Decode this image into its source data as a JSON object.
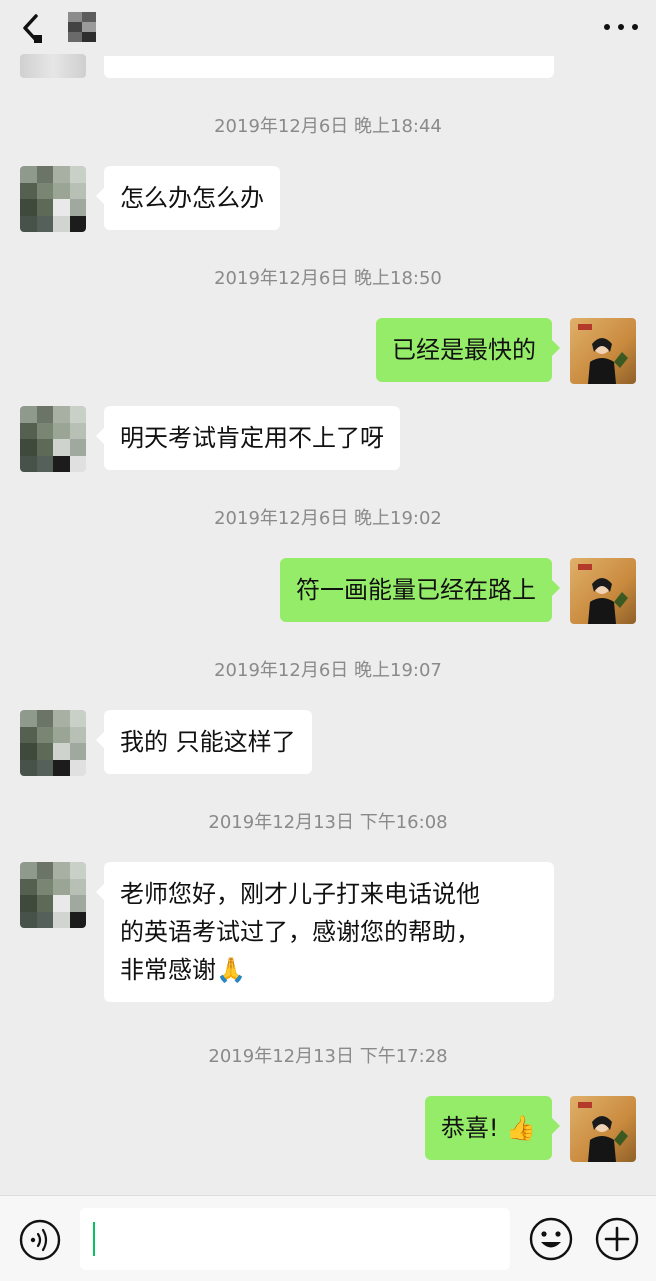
{
  "header": {
    "back_icon": "chevron-left-icon",
    "contact_name_icon": "blurred-name",
    "more_icon": "more-dots-icon"
  },
  "messages": [
    {
      "type": "timestamp",
      "text": "2019年12月6日 晚上18:44"
    },
    {
      "type": "incoming",
      "text": "怎么办怎么办"
    },
    {
      "type": "timestamp",
      "text": "2019年12月6日 晚上18:50"
    },
    {
      "type": "outgoing",
      "text": "已经是最快的"
    },
    {
      "type": "incoming",
      "text": "明天考试肯定用不上了呀"
    },
    {
      "type": "timestamp",
      "text": "2019年12月6日 晚上19:02"
    },
    {
      "type": "outgoing",
      "text": "符一画能量已经在路上"
    },
    {
      "type": "timestamp",
      "text": "2019年12月6日 晚上19:07"
    },
    {
      "type": "incoming",
      "text": "我的 只能这样了"
    },
    {
      "type": "timestamp",
      "text": "2019年12月13日 下午16:08"
    },
    {
      "type": "incoming",
      "lines": [
        "老师您好，刚才儿子打来电话说他",
        "的英语考试过了，感谢您的帮助，",
        "非常感谢"
      ],
      "emoji": "🙏"
    },
    {
      "type": "timestamp",
      "text": "2019年12月13日 下午17:28"
    },
    {
      "type": "outgoing",
      "text": "恭喜!",
      "emoji": "👍"
    }
  ],
  "input_bar": {
    "voice_icon": "voice-icon",
    "input_value": "",
    "emoji_icon": "emoji-smile-icon",
    "plus_icon": "plus-circle-icon"
  },
  "colors": {
    "background": "#ededed",
    "outgoing_bubble": "#95ec69",
    "incoming_bubble": "#ffffff",
    "timestamp_text": "#8a8a8a",
    "cursor": "#07c160"
  }
}
